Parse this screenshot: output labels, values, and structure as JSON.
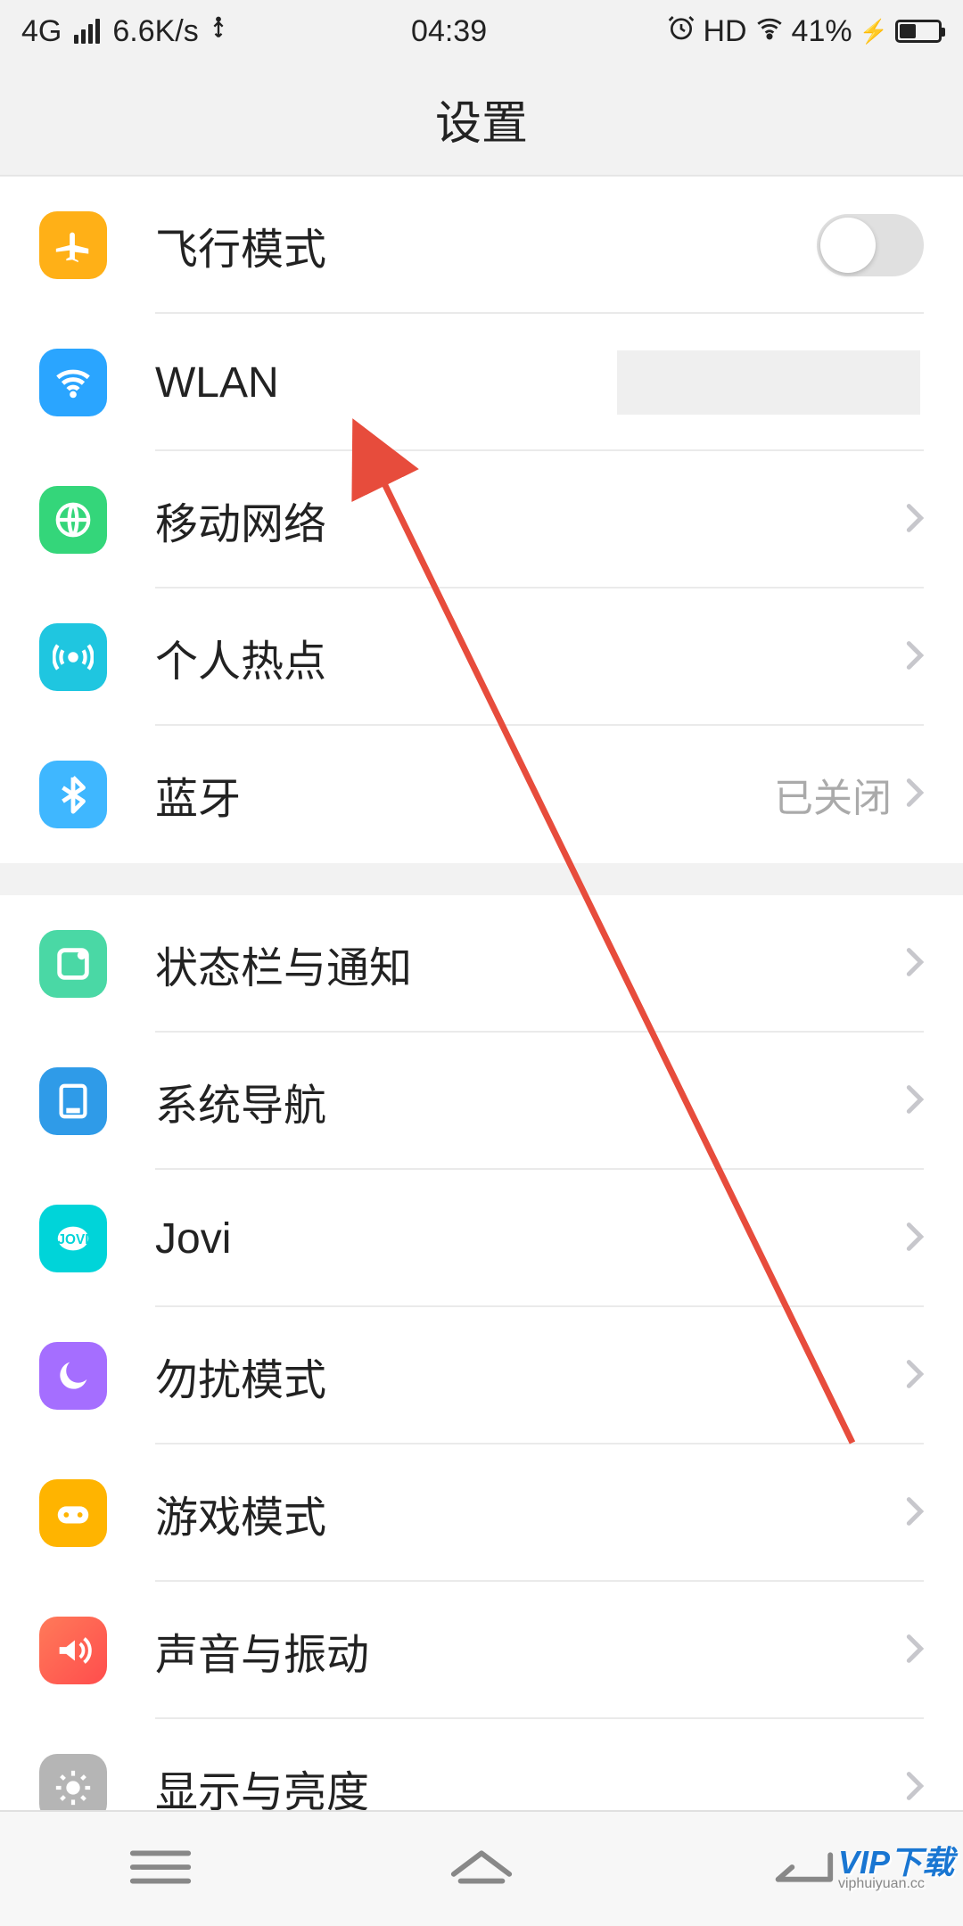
{
  "status": {
    "network": "4G",
    "speed": "6.6K/s",
    "time": "04:39",
    "hd": "HD",
    "battery_pct": "41%"
  },
  "title": "设置",
  "groups": [
    {
      "rows": [
        {
          "id": "airplane",
          "icon": "airplane-icon",
          "bg": "bg-orange",
          "label": "飞行模式",
          "control": "toggle",
          "toggle_on": false
        },
        {
          "id": "wlan",
          "icon": "wifi-icon",
          "bg": "bg-blue",
          "label": "WLAN",
          "control": "redacted"
        },
        {
          "id": "mobile",
          "icon": "globe-icon",
          "bg": "bg-green",
          "label": "移动网络",
          "control": "chevron"
        },
        {
          "id": "hotspot",
          "icon": "hotspot-icon",
          "bg": "bg-teal",
          "label": "个人热点",
          "control": "chevron"
        },
        {
          "id": "bluetooth",
          "icon": "bluetooth-icon",
          "bg": "bg-bt",
          "label": "蓝牙",
          "control": "value-chevron",
          "value": "已关闭"
        }
      ]
    },
    {
      "rows": [
        {
          "id": "status-notif",
          "icon": "notif-icon",
          "bg": "bg-mint",
          "label": "状态栏与通知",
          "control": "chevron"
        },
        {
          "id": "sysnav",
          "icon": "sysnav-icon",
          "bg": "bg-nav",
          "label": "系统导航",
          "control": "chevron"
        },
        {
          "id": "jovi",
          "icon": "jovi-icon",
          "bg": "bg-jovi",
          "label": "Jovi",
          "control": "chevron"
        },
        {
          "id": "dnd",
          "icon": "moon-icon",
          "bg": "bg-purple",
          "label": "勿扰模式",
          "control": "chevron"
        },
        {
          "id": "game",
          "icon": "game-icon",
          "bg": "bg-amber",
          "label": "游戏模式",
          "control": "chevron"
        },
        {
          "id": "sound",
          "icon": "sound-icon",
          "bg": "bg-red",
          "label": "声音与振动",
          "control": "chevron"
        },
        {
          "id": "display",
          "icon": "brightness-icon",
          "bg": "bg-gray",
          "label": "显示与亮度",
          "control": "chevron"
        }
      ]
    }
  ],
  "watermark": {
    "brand": "VIP下载",
    "url": "viphuiyuan.cc"
  }
}
